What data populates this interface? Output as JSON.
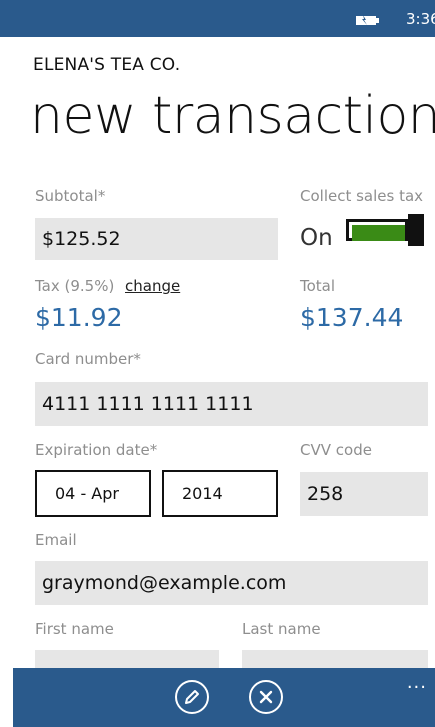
{
  "status": {
    "time": "3:36"
  },
  "app": {
    "name": "ELENA'S TEA CO.",
    "page_title": "new transaction"
  },
  "form": {
    "subtotal": {
      "label": "Subtotal",
      "required_mark": "*",
      "value": "$125.52"
    },
    "sales_tax": {
      "label": "Collect sales tax",
      "state": "On"
    },
    "tax": {
      "label": "Tax (9.5%)",
      "change_link": "change",
      "value": "$11.92"
    },
    "total": {
      "label": "Total",
      "value": "$137.44"
    },
    "card_number": {
      "label": "Card number",
      "required_mark": "*",
      "value": "4111 1111 1111 1111"
    },
    "expiration": {
      "label": "Expiration date",
      "required_mark": "*",
      "month": "04 - Apr",
      "year": "2014"
    },
    "cvv": {
      "label": "CVV code",
      "value": "258"
    },
    "email": {
      "label": "Email",
      "value": "graymond@example.com"
    },
    "first_name": {
      "label": "First name"
    },
    "last_name": {
      "label": "Last name"
    }
  },
  "appbar": {
    "more": "..."
  },
  "colors": {
    "accent": "#2a5a8c",
    "value_blue": "#2d6aa6",
    "toggle_on": "#3a8b16"
  },
  "icons": [
    "battery-icon",
    "edit-icon",
    "cancel-icon",
    "more-icon"
  ]
}
